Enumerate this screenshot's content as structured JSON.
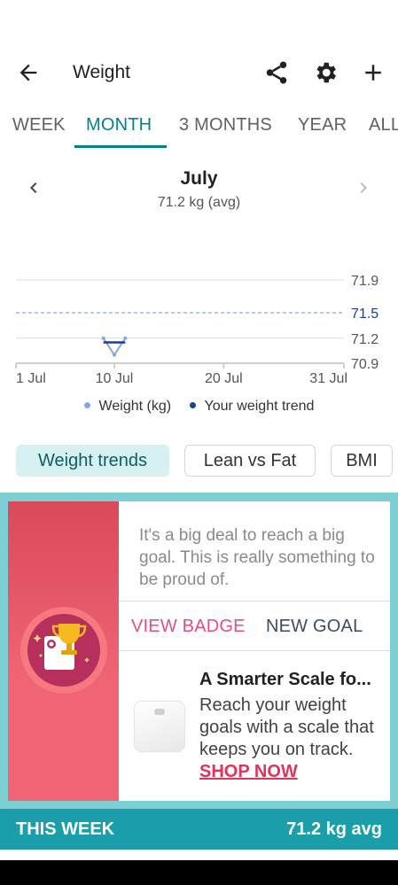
{
  "header": {
    "title": "Weight"
  },
  "tabs": [
    "WEEK",
    "MONTH",
    "3 MONTHS",
    "YEAR",
    "ALL"
  ],
  "active_tab": "MONTH",
  "period": {
    "title": "July",
    "subtitle": "71.2 kg (avg)"
  },
  "chart_data": {
    "type": "line",
    "x_range": [
      "1 Jul",
      "31 Jul"
    ],
    "xticks": [
      "1 Jul",
      "10 Jul",
      "20 Jul",
      "31 Jul"
    ],
    "yticks": [
      71.9,
      71.5,
      71.2,
      70.9
    ],
    "ylim": [
      70.9,
      71.9
    ],
    "trend_line_value": 71.5,
    "series": [
      {
        "name": "Weight (kg)",
        "color": "#7fa8e6",
        "points": [
          {
            "x": "9 Jul",
            "y": 71.2
          },
          {
            "x": "10 Jul",
            "y": 71.0
          },
          {
            "x": "11 Jul",
            "y": 71.2
          }
        ]
      },
      {
        "name": "Your weight trend",
        "color": "#1a3f9e",
        "points": [
          {
            "x": "9 Jul",
            "y": 71.15
          },
          {
            "x": "11 Jul",
            "y": 71.15
          }
        ]
      }
    ],
    "legend": [
      "Weight (kg)",
      "Your weight trend"
    ]
  },
  "chips": [
    "Weight trends",
    "Lean vs Fat",
    "BMI"
  ],
  "promo": {
    "message": "It's a big deal to reach a big goal. This is really something to be proud of.",
    "view_badge": "VIEW BADGE",
    "new_goal": "NEW GOAL",
    "ad_title": "A Smarter Scale fo...",
    "ad_body": "Reach your weight goals with a scale that keeps you on track.",
    "shop_now": "SHOP NOW"
  },
  "footer": {
    "label": "THIS WEEK",
    "value": "71.2 kg avg"
  },
  "colors": {
    "accent": "#00838f",
    "footer": "#1a9eaa",
    "promo_bg": "#7ecfd3",
    "badge_pink": "#e94b83",
    "trend_blue": "#1a3f9e"
  }
}
